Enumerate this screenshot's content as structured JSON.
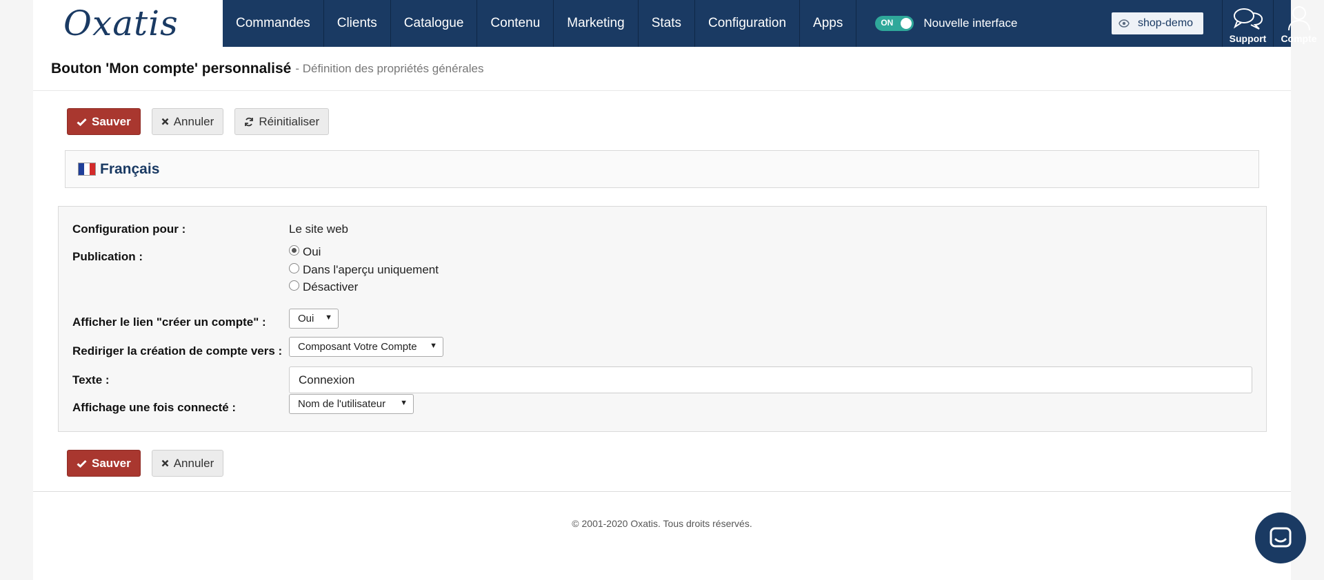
{
  "header": {
    "logo_text": "Oxatis",
    "nav": [
      "Commandes",
      "Clients",
      "Catalogue",
      "Contenu",
      "Marketing",
      "Stats",
      "Configuration",
      "Apps"
    ],
    "toggle_state": "ON",
    "toggle_label": "Nouvelle interface",
    "shop_button": "shop-demo",
    "support_label": "Support",
    "account_label": "Compte"
  },
  "page": {
    "title": "Bouton 'Mon compte' personnalisé",
    "subtitle": "- Définition des propriétés générales"
  },
  "actions": {
    "save": "Sauver",
    "cancel": "Annuler",
    "reset": "Réinitialiser"
  },
  "language": {
    "label": "Français"
  },
  "form": {
    "config_label": "Configuration pour :",
    "config_value": "Le site web",
    "publication_label": "Publication :",
    "publication_options": [
      "Oui",
      "Dans l'aperçu uniquement",
      "Désactiver"
    ],
    "publication_selected": "Oui",
    "show_link_label": "Afficher le lien \"créer un compte\" :",
    "show_link_value": "Oui",
    "redirect_label": "Rediriger la création de compte vers :",
    "redirect_value": "Composant Votre Compte",
    "text_label": "Texte :",
    "text_value": "Connexion",
    "display_label": "Affichage une fois connecté :",
    "display_value": "Nom de l'utilisateur"
  },
  "footer": {
    "copyright": "© 2001-2020 Oxatis. Tous droits réservés."
  },
  "colors": {
    "nav_bg": "#1a3a63",
    "primary_btn": "#a9372f",
    "toggle_on": "#2fa89a"
  }
}
